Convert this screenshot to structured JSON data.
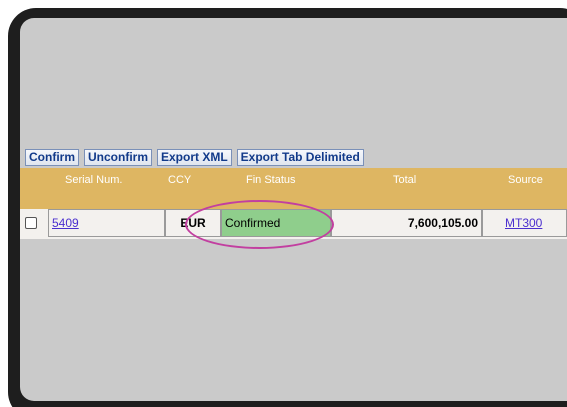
{
  "toolbar": {
    "confirm": "Confirm",
    "unconfirm": "Unconfirm",
    "export_xml": "Export XML",
    "export_tab": "Export Tab Delimited"
  },
  "table": {
    "headers": {
      "serial": "Serial Num.",
      "ccy": "CCY",
      "fin_status": "Fin Status",
      "total": "Total",
      "source": "Source"
    },
    "rows": [
      {
        "serial": "5409",
        "ccy": "EUR",
        "fin_status": "Confirmed",
        "total": "7,600,105.00",
        "source": "MT300"
      }
    ]
  },
  "colors": {
    "header_bg": "#deb662",
    "confirmed_bg": "#8fce8c",
    "annotation": "#c23fa0",
    "link": "#4b2fcf"
  }
}
